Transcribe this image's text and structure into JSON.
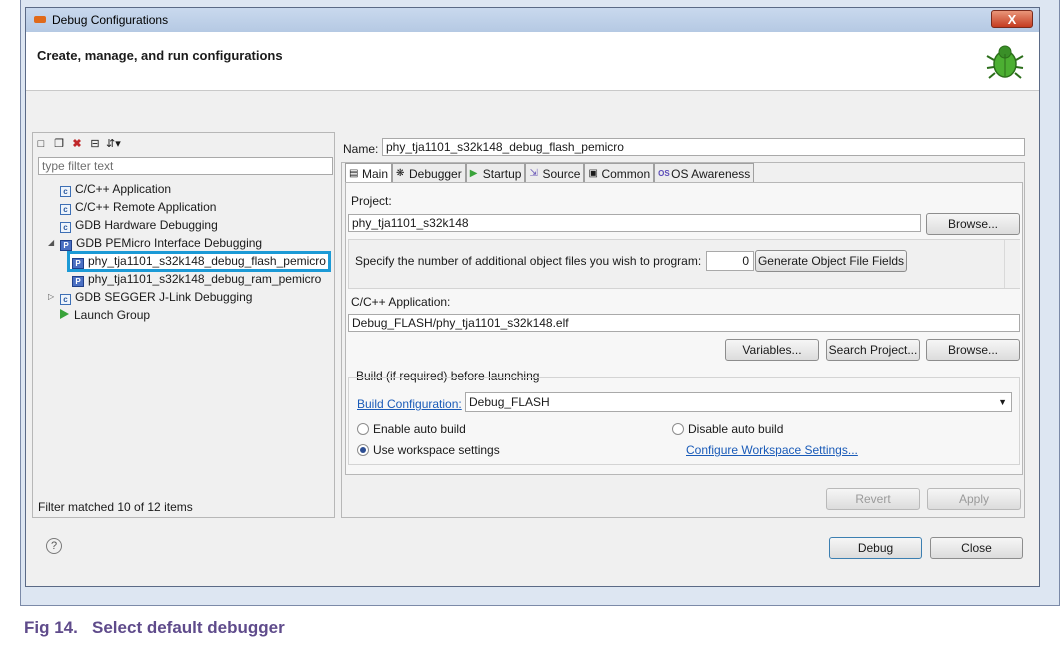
{
  "window": {
    "title": "Debug Configurations",
    "close": "X"
  },
  "header": {
    "title": "Create, manage, and run configurations"
  },
  "left": {
    "filter_placeholder": "type filter text",
    "tree": [
      {
        "label": "C/C++ Application",
        "icon": "c-icon"
      },
      {
        "label": "C/C++ Remote Application",
        "icon": "c-icon"
      },
      {
        "label": "GDB Hardware Debugging",
        "icon": "c-icon"
      },
      {
        "label": "GDB PEMicro Interface Debugging",
        "icon": "pemicro-icon"
      },
      {
        "label": "phy_tja1101_s32k148_debug_flash_pemicro",
        "icon": "pemicro-icon"
      },
      {
        "label": "phy_tja1101_s32k148_debug_ram_pemicro",
        "icon": "pemicro-icon"
      },
      {
        "label": "GDB SEGGER J-Link Debugging",
        "icon": "c-icon"
      },
      {
        "label": "Launch Group",
        "icon": "launch-icon"
      }
    ],
    "status": "Filter matched 10 of 12 items"
  },
  "right": {
    "name_label": "Name:",
    "name_value": "phy_tja1101_s32k148_debug_flash_pemicro",
    "tabs": [
      "Main",
      "Debugger",
      "Startup",
      "Source",
      "Common",
      "OS Awareness"
    ],
    "project_label": "Project:",
    "project_value": "phy_tja1101_s32k148",
    "browse": "Browse...",
    "object_files_label": "Specify the number of additional object files you wish to program:",
    "object_files_value": "0",
    "generate_btn": "Generate Object File Fields",
    "app_label": "C/C++ Application:",
    "app_value": "Debug_FLASH/phy_tja1101_s32k148.elf",
    "variables_btn": "Variables...",
    "search_btn": "Search Project...",
    "browse2": "Browse...",
    "build_group": "Build (if required) before launching",
    "build_config_link": "Build Configuration:",
    "build_config_value": "Debug_FLASH",
    "enable_auto": "Enable auto build",
    "disable_auto": "Disable auto build",
    "use_workspace": "Use workspace settings",
    "configure_ws": "Configure Workspace Settings...",
    "revert": "Revert",
    "apply": "Apply"
  },
  "footer": {
    "help": "?",
    "debug": "Debug",
    "close": "Close"
  },
  "caption": "Fig 14.   Select default debugger"
}
